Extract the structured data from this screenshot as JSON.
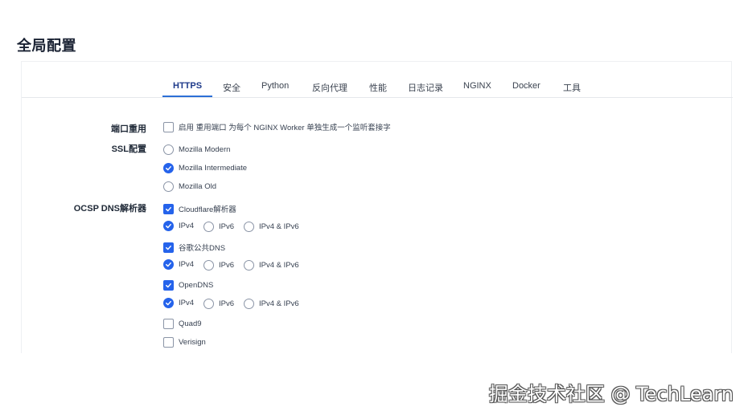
{
  "page": {
    "title": "全局配置"
  },
  "tabs": [
    {
      "label": "HTTPS",
      "active": true
    },
    {
      "label": "安全"
    },
    {
      "label": "Python"
    },
    {
      "label": "反向代理"
    },
    {
      "label": "性能"
    },
    {
      "label": "日志记录"
    },
    {
      "label": "NGINX"
    },
    {
      "label": "Docker"
    },
    {
      "label": "工具"
    }
  ],
  "port_reuse": {
    "label": "端口重用",
    "option": {
      "text": "启用 重用端口 为每个 NGINX Worker 单独生成一个监听套接字",
      "checked": false
    }
  },
  "ssl": {
    "label": "SSL配置",
    "options": [
      {
        "text": "Mozilla Modern",
        "selected": false
      },
      {
        "text": "Mozilla Intermediate",
        "selected": true
      },
      {
        "text": "Mozilla Old",
        "selected": false
      }
    ]
  },
  "ocsp": {
    "label": "OCSP DNS解析器",
    "resolvers": [
      {
        "name": "Cloudflare解析器",
        "checked": true,
        "ip": [
          "IPv4",
          "IPv6",
          "IPv4 & IPv6"
        ],
        "ip_selected": "IPv4"
      },
      {
        "name": "谷歌公共DNS",
        "checked": true,
        "ip": [
          "IPv4",
          "IPv6",
          "IPv4 & IPv6"
        ],
        "ip_selected": "IPv4"
      },
      {
        "name": "OpenDNS",
        "checked": true,
        "ip": [
          "IPv4",
          "IPv6",
          "IPv4 & IPv6"
        ],
        "ip_selected": "IPv4"
      },
      {
        "name": "Quad9",
        "checked": false
      },
      {
        "name": "Verisign",
        "checked": false
      }
    ]
  },
  "watermark": "掘金技术社区 @ TechLearn",
  "colors": {
    "accent": "#2563eb",
    "tab_active": "#1e3a8a",
    "title": "#1a2233"
  }
}
